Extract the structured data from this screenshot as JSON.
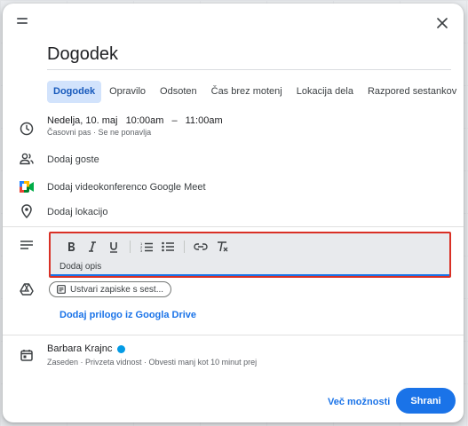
{
  "dialog": {
    "title_value": "Dogodek",
    "tabs": [
      {
        "label": "Dogodek",
        "active": true
      },
      {
        "label": "Opravilo"
      },
      {
        "label": "Odsoten"
      },
      {
        "label": "Čas brez motenj"
      },
      {
        "label": "Lokacija dela"
      },
      {
        "label": "Razpored sestankov"
      }
    ],
    "datetime": {
      "date": "Nedelja, 10. maj",
      "start": "10:00am",
      "dash": "–",
      "end": "11:00am",
      "sub": "Časovni pas · Se ne ponavlja"
    },
    "guests_label": "Dodaj goste",
    "meet_label": "Dodaj videokonferenco Google Meet",
    "location_label": "Dodaj lokacijo",
    "description": {
      "placeholder": "Dodaj opis",
      "toolbar": [
        "bold",
        "italic",
        "underline",
        "numbered-list",
        "bulleted-list",
        "link",
        "clear-formatting"
      ]
    },
    "notes_chip_label": "Ustvari zapiske s sest...",
    "drive_link": "Dodaj prilogo iz Googla Drive",
    "owner": {
      "name": "Barbara Krajnc",
      "color": "#039be5",
      "details": "Zaseden · Privzeta vidnost · Obvesti manj kot 10 minut prej"
    },
    "more_options_label": "Več možnosti",
    "save_label": "Shrani",
    "accent": "#1a73e8",
    "highlight": "#d93025"
  }
}
